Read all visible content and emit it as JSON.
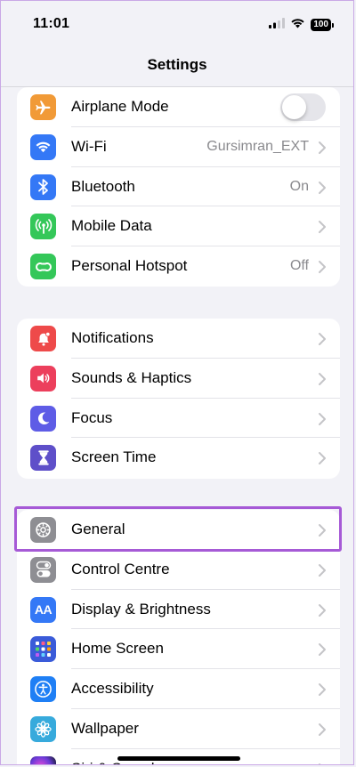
{
  "status_bar": {
    "time": "11:01",
    "battery": "100"
  },
  "nav": {
    "title": "Settings"
  },
  "colors": {
    "airplane": "#f19a37",
    "wifi": "#3478f6",
    "bluetooth": "#3478f6",
    "mobile_data": "#34c759",
    "hotspot": "#34c759",
    "notifications": "#ee4a4a",
    "sounds": "#ec3f5c",
    "focus": "#5e5ce6",
    "screen_time": "#5e4fc9",
    "general": "#8e8e93",
    "control_centre": "#8e8e93",
    "display": "#3478f6",
    "home_screen": "#3a5bd9",
    "accessibility": "#1f7ff5",
    "wallpaper": "#37aadc",
    "highlight": "#a65ad6"
  },
  "groups": [
    {
      "items": [
        {
          "label": "Airplane Mode",
          "icon": "airplane-icon",
          "control": "toggle",
          "toggle_on": false
        },
        {
          "label": "Wi-Fi",
          "icon": "wifi-icon",
          "value": "Gursimran_EXT"
        },
        {
          "label": "Bluetooth",
          "icon": "bluetooth-icon",
          "value": "On"
        },
        {
          "label": "Mobile Data",
          "icon": "antenna-icon",
          "value": ""
        },
        {
          "label": "Personal Hotspot",
          "icon": "hotspot-link-icon",
          "value": "Off"
        }
      ]
    },
    {
      "items": [
        {
          "label": "Notifications",
          "icon": "bell-icon"
        },
        {
          "label": "Sounds & Haptics",
          "icon": "speaker-icon"
        },
        {
          "label": "Focus",
          "icon": "moon-icon"
        },
        {
          "label": "Screen Time",
          "icon": "hourglass-icon"
        }
      ]
    },
    {
      "items": [
        {
          "label": "General",
          "icon": "gear-icon",
          "highlighted": true
        },
        {
          "label": "Control Centre",
          "icon": "switches-icon"
        },
        {
          "label": "Display & Brightness",
          "icon": "aa-text-icon",
          "icon_text": "AA"
        },
        {
          "label": "Home Screen",
          "icon": "app-grid-icon"
        },
        {
          "label": "Accessibility",
          "icon": "accessibility-icon"
        },
        {
          "label": "Wallpaper",
          "icon": "flower-icon"
        },
        {
          "label": "Siri & Search",
          "icon": "siri-icon"
        }
      ]
    }
  ]
}
